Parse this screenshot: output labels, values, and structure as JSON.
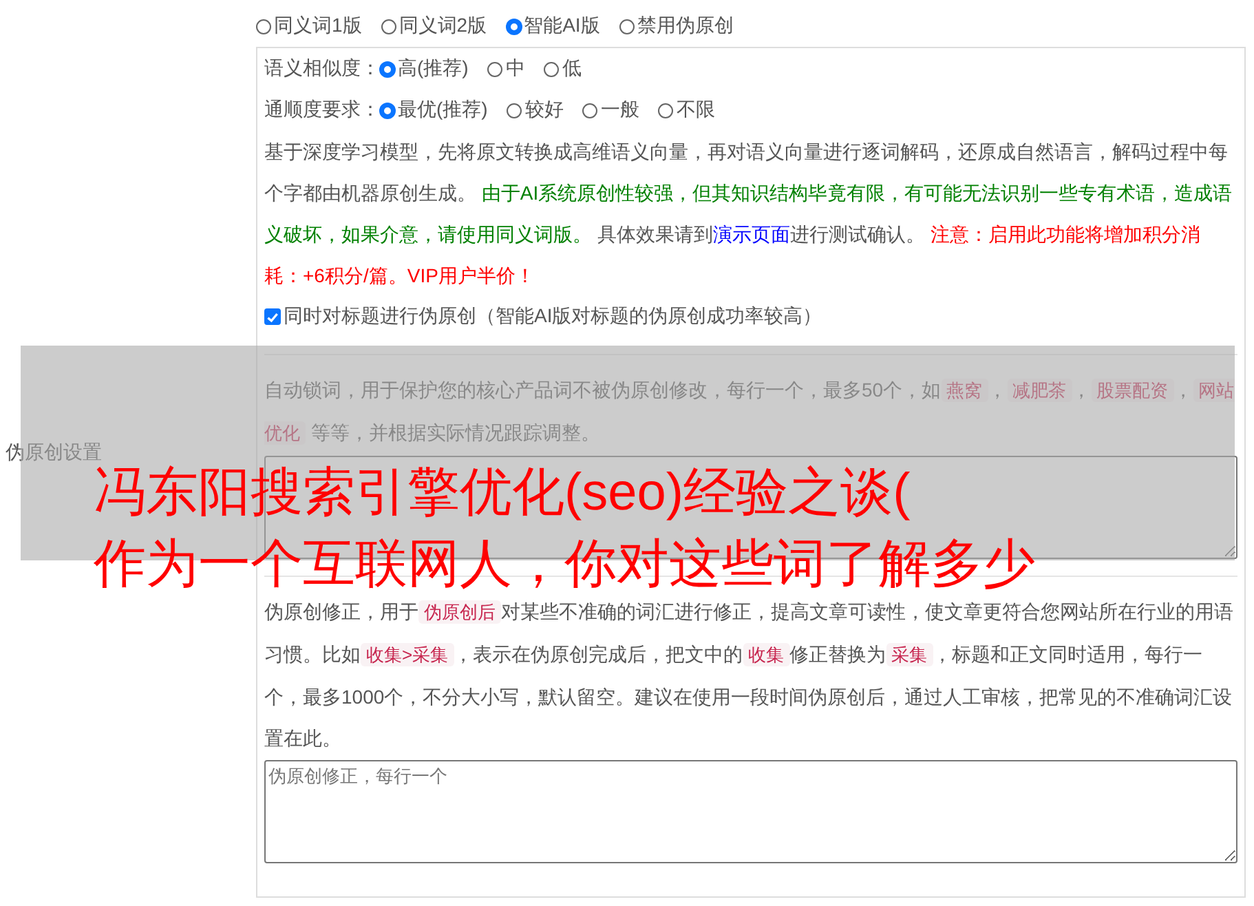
{
  "side_label": "伪原创设置",
  "mode_options": [
    {
      "label": "同义词1版",
      "selected": false
    },
    {
      "label": "同义词2版",
      "selected": false
    },
    {
      "label": "智能AI版",
      "selected": true
    },
    {
      "label": "禁用伪原创",
      "selected": false
    }
  ],
  "ai_panel": {
    "similarity": {
      "label": "语义相似度：",
      "options": [
        {
          "label": "高(推荐)",
          "selected": true
        },
        {
          "label": "中",
          "selected": false
        },
        {
          "label": "低",
          "selected": false
        }
      ]
    },
    "fluency": {
      "label": "通顺度要求：",
      "options": [
        {
          "label": "最优(推荐)",
          "selected": true
        },
        {
          "label": "较好",
          "selected": false
        },
        {
          "label": "一般",
          "selected": false
        },
        {
          "label": "不限",
          "selected": false
        }
      ]
    },
    "description": [
      {
        "kind": "plain",
        "text": "基于深度学习模型，先将原文转换成高维语义向量，再对语义向量进行逐词解码，还原成自然语言，解码过程中每个字都由机器原创生成。 "
      },
      {
        "kind": "good",
        "text": "由于AI系统原创性较强，但其知识结构毕竟有限，有可能无法识别一些专有术语，造成语义破坏，如果介意，请使用同义词版。"
      },
      {
        "kind": "plain",
        "text": " 具体效果请到"
      },
      {
        "kind": "link",
        "text": "演示页面"
      },
      {
        "kind": "plain",
        "text": "进行测试确认。 "
      },
      {
        "kind": "warn",
        "text": "注意：启用此功能将增加积分消耗：+6积分/篇。VIP用户半价！"
      }
    ],
    "title_checkbox": {
      "label": "同时对标题进行伪原创（智能AI版对标题的伪原创成功率较高）",
      "checked": true
    }
  },
  "lock_words": {
    "description": [
      {
        "kind": "plain",
        "text": "自动锁词，用于保护您的核心产品词不被伪原创修改，每行一个，最多50个，如"
      },
      {
        "kind": "code",
        "text": "燕窝"
      },
      {
        "kind": "plain",
        "text": "，"
      },
      {
        "kind": "code",
        "text": "减肥茶"
      },
      {
        "kind": "plain",
        "text": "，"
      },
      {
        "kind": "code",
        "text": "股票配资"
      },
      {
        "kind": "plain",
        "text": "，"
      },
      {
        "kind": "code",
        "text": "网站优化"
      },
      {
        "kind": "plain",
        "text": " 等等，并根据实际情况跟踪调整。"
      }
    ]
  },
  "correction": {
    "description": [
      {
        "kind": "plain",
        "text": "伪原创修正，用于"
      },
      {
        "kind": "code",
        "text": "伪原创后"
      },
      {
        "kind": "plain",
        "text": "对某些不准确的词汇进行修正，提高文章可读性，使文章更符合您网站所在行业的用语习惯。比如"
      },
      {
        "kind": "code",
        "text": "收集>采集"
      },
      {
        "kind": "plain",
        "text": "，表示在伪原创完成后，把文中的"
      },
      {
        "kind": "code",
        "text": "收集"
      },
      {
        "kind": "plain",
        "text": "修正替换为"
      },
      {
        "kind": "code",
        "text": "采集"
      },
      {
        "kind": "plain",
        "text": "，标题和正文同时适用，每行一个，最多1000个，不分大小写，默认留空。建议在使用一段时间伪原创后，通过人工审核，把常见的不准确词汇设置在此。"
      }
    ],
    "textarea": {
      "placeholder": "伪原创修正，每行一个"
    }
  },
  "overlay_title": {
    "lines": [
      "冯东阳搜索引擎优化(seo)经验之谈(",
      "作为一个互联网人，你对这些词了解多少"
    ]
  }
}
